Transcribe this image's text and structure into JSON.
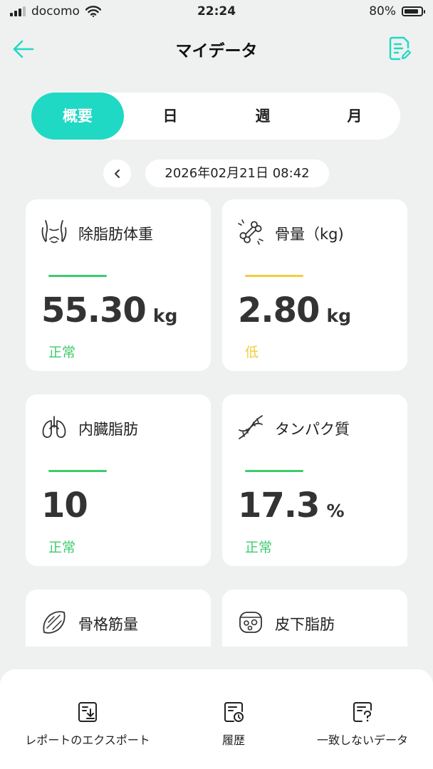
{
  "status_bar": {
    "carrier": "docomo",
    "time": "22:24",
    "battery": "80%"
  },
  "header": {
    "title": "マイデータ"
  },
  "tabs": [
    {
      "label": "概要",
      "active": true
    },
    {
      "label": "日",
      "active": false
    },
    {
      "label": "週",
      "active": false
    },
    {
      "label": "月",
      "active": false
    }
  ],
  "date": {
    "value": "2026年02月21日 08:42"
  },
  "cards": [
    {
      "title": "除脂肪体重",
      "value": "55.30",
      "unit": "kg",
      "status": "正常",
      "icon": "torso-icon",
      "status_color": "#3ecb6e"
    },
    {
      "title": "骨量（kg)",
      "value": "2.80",
      "unit": "kg",
      "status": "低",
      "icon": "bone-icon",
      "status_color": "#f2cd3b"
    },
    {
      "title": "内臓脂肪",
      "value": "10",
      "unit": "",
      "status": "正常",
      "icon": "lungs-icon",
      "status_color": "#3ecb6e"
    },
    {
      "title": "タンパク質",
      "value": "17.3",
      "unit": "%",
      "status": "正常",
      "icon": "dna-icon",
      "status_color": "#3ecb6e"
    },
    {
      "title": "骨格筋量",
      "value": "",
      "unit": "",
      "status": "",
      "icon": "muscle-icon"
    },
    {
      "title": "皮下脂肪",
      "value": "",
      "unit": "",
      "status": "",
      "icon": "fat-cells-icon"
    }
  ],
  "bottom_actions": [
    {
      "label": "レポートのエクスポート",
      "icon": "export-report-icon"
    },
    {
      "label": "履歴",
      "icon": "history-icon"
    },
    {
      "label": "一致しないデータ",
      "icon": "unmatched-data-icon"
    }
  ],
  "colors": {
    "accent": "#1fd9c4",
    "normal": "#3ecb6e",
    "low": "#f2cd3b"
  }
}
